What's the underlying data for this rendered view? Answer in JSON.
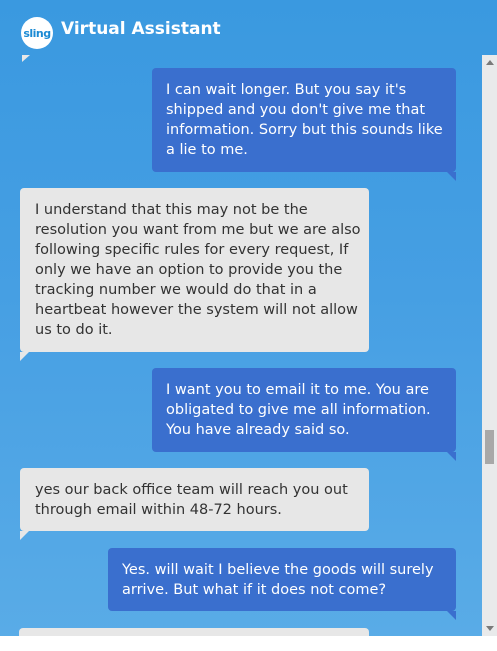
{
  "header": {
    "logo_text": "sling",
    "title": "Virtual Assistant"
  },
  "messages": [
    {
      "sender": "user",
      "lines": [
        "I can wait longer. But you say it's",
        "shipped and you don't give me that",
        "information. Sorry but this sounds like",
        "a lie to me."
      ]
    },
    {
      "sender": "bot",
      "lines": [
        "I understand that this may not be the",
        "resolution you want from me but we are also",
        "following specific rules for every request, If",
        "only we have an option to provide you the",
        "tracking number we would do that in a",
        "heartbeat however the system will not allow",
        "us to do it."
      ]
    },
    {
      "sender": "user",
      "lines": [
        "I want you to email it to me. You are",
        "obligated to give me all information.",
        "You have already said so."
      ]
    },
    {
      "sender": "bot",
      "lines": [
        "yes our back office team will reach you out",
        "through email within 48-72 hours."
      ]
    },
    {
      "sender": "user",
      "lines": [
        "Yes. will wait I believe the goods will surely",
        "arrive. But what if it does not come?"
      ]
    }
  ],
  "colors": {
    "background": "#469fe3",
    "user_bubble": "#3a6fce",
    "bot_bubble": "#e7e7e7",
    "scrollbar": "#e9eaeb"
  }
}
